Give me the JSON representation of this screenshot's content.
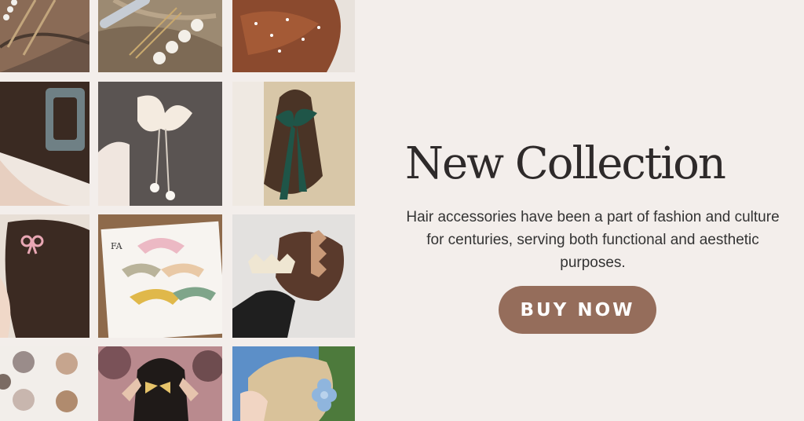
{
  "hero": {
    "title": "New Collection",
    "description": "Hair accessories have been a part of fashion and culture for centuries, serving both functional and aesthetic purposes.",
    "cta_label": "BUY NOW"
  },
  "photos": [
    {
      "subject": "pearl bobby pins"
    },
    {
      "subject": "pearl hair pin"
    },
    {
      "subject": "pearl hair studs"
    },
    {
      "subject": "glitter claw clip"
    },
    {
      "subject": "fluffy bow hair pin"
    },
    {
      "subject": "green satin bow"
    },
    {
      "subject": "pink mini bow clip"
    },
    {
      "subject": "colorful claw clips set",
      "print_text": "FA"
    },
    {
      "subject": "wavy claw clips"
    },
    {
      "subject": "flower claw clips"
    },
    {
      "subject": "butterfly hair clip"
    },
    {
      "subject": "blue flower clip"
    }
  ],
  "colors": {
    "background": "#f3eeeb",
    "button": "#956d5b",
    "title": "#2e2a2a"
  }
}
